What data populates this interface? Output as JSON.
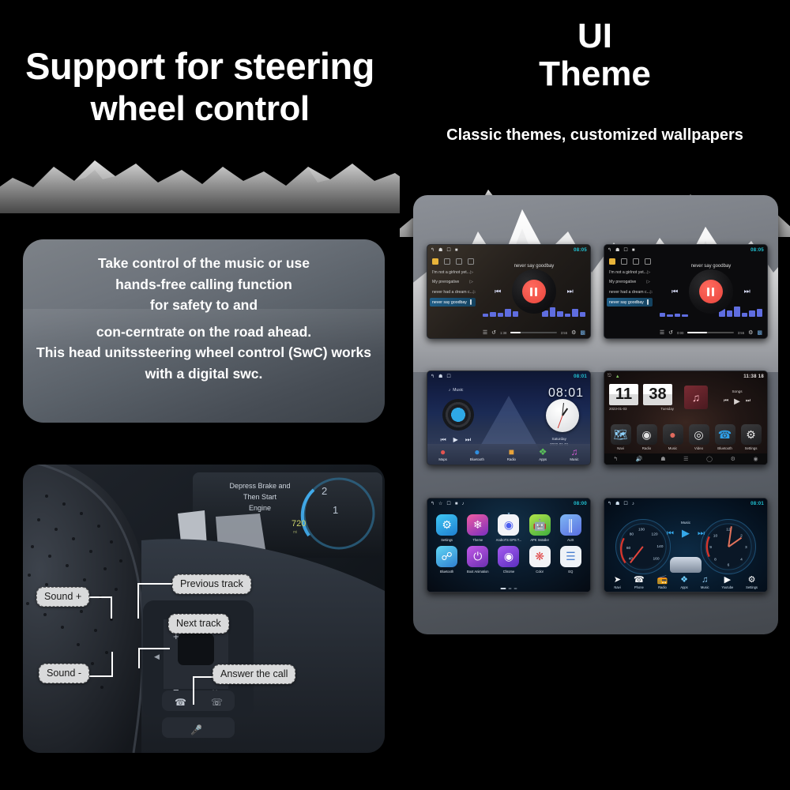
{
  "left": {
    "title_line1": "Support for steering",
    "title_line2": "wheel control",
    "description": {
      "line1": "Take control of the music or use",
      "line2": "hands-free calling function",
      "line3": "for safety to and",
      "line4": "con-cerntrate on the road ahead.",
      "line5": "This head unitssteering wheel control (SwC) works",
      "line6": "with a digital swc."
    },
    "wheel_labels": {
      "sound_up": "Sound +",
      "previous_track": "Previous track",
      "next_track": "Next track",
      "sound_down": "Sound -",
      "answer_call": "Answer the call"
    },
    "dashboard_text": {
      "line1": "Depress Brake and",
      "line2": "Then Start",
      "line3": "Engine",
      "range": "720",
      "range_unit": "mi"
    }
  },
  "right": {
    "title_line1": "UI",
    "title_line2": "Theme",
    "subtitle": "Classic themes, customized wallpapers",
    "screens": {
      "music_light": {
        "name": "music-player-light",
        "status_time": "08:05",
        "now_playing": "never say goodbay",
        "playlist": [
          "I'm not a girlnot yet...",
          "My prerogative",
          "never had a dream c...",
          "never say goodbay"
        ],
        "selected_index": 3,
        "time_elapsed": "1:38",
        "time_total": "3:55"
      },
      "music_dark": {
        "name": "music-player-dark",
        "status_time": "08:05",
        "now_playing": "never say goodbay",
        "playlist": [
          "I'm not a girlnot yet...",
          "My prerogative",
          "never had a dream c...",
          "never say goodbay"
        ],
        "selected_index": 3,
        "time_elapsed": "0:00",
        "time_total": "3:55"
      },
      "home_road": {
        "name": "home-road-theme",
        "status_time": "08:01",
        "clock": "08:01",
        "music_label": "Music",
        "weekday": "Saturday",
        "date": "2022-01-01",
        "dock": [
          "Maps",
          "Bluetooth",
          "Radio",
          "Apps",
          "Music"
        ]
      },
      "flip_clock": {
        "name": "flip-clock-theme",
        "status_time": "11:38",
        "status_extra": "18",
        "hour": "11",
        "minute": "38",
        "date": "2023-01-03",
        "weekday": "Tuesday",
        "music_label": "Songs",
        "apps": [
          "Navi",
          "Radio",
          "Music",
          "Video",
          "Bluetooth",
          "Settings"
        ]
      },
      "app_grid": {
        "name": "app-drawer",
        "status_time": "08:00",
        "apps_row1": [
          "Settings",
          "Theme",
          "AndroTS GPS T...",
          "APK Installer",
          "AUX"
        ],
        "apps_row2": [
          "Bluetooth",
          "Boot Animation",
          "Chrome",
          "Color",
          "EQ"
        ]
      },
      "gauge": {
        "name": "gauge-dashboard-theme",
        "status_time": "08:01",
        "music_label": "Music",
        "speed_ticks": [
          "20",
          "40",
          "60",
          "80",
          "100",
          "120",
          "140",
          "160"
        ],
        "dock": [
          "Navi",
          "Phone",
          "Radio",
          "Apps",
          "Music",
          "Youtube",
          "Settings"
        ]
      }
    }
  },
  "colors": {
    "background": "#000000",
    "card_grey": "#6e747c",
    "accent_red": "#e8453c",
    "accent_cyan": "#21c7d8",
    "accent_blue": "#35a8ea",
    "label_bg": "#d9dadb"
  }
}
